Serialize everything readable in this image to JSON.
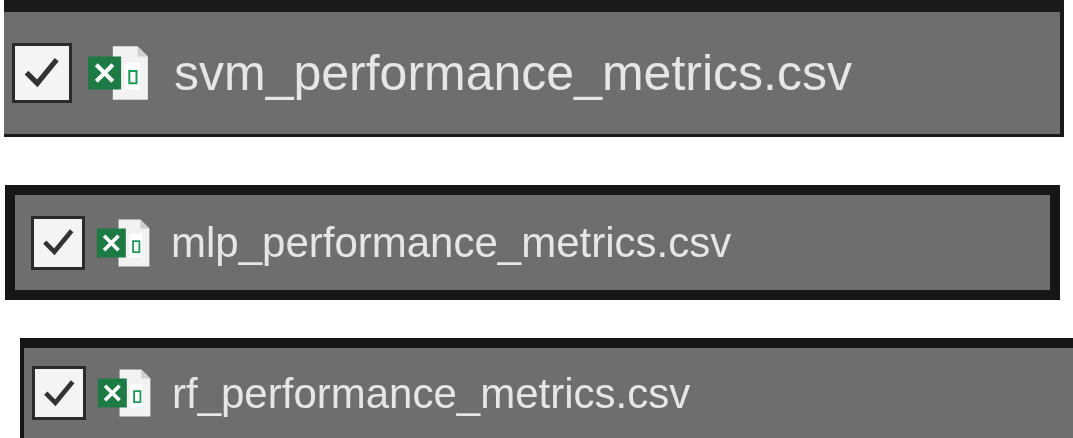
{
  "files": [
    {
      "name": "svm_performance_metrics.csv",
      "checked": true
    },
    {
      "name": "mlp_performance_metrics.csv",
      "checked": true
    },
    {
      "name": "rf_performance_metrics.csv",
      "checked": true
    }
  ]
}
